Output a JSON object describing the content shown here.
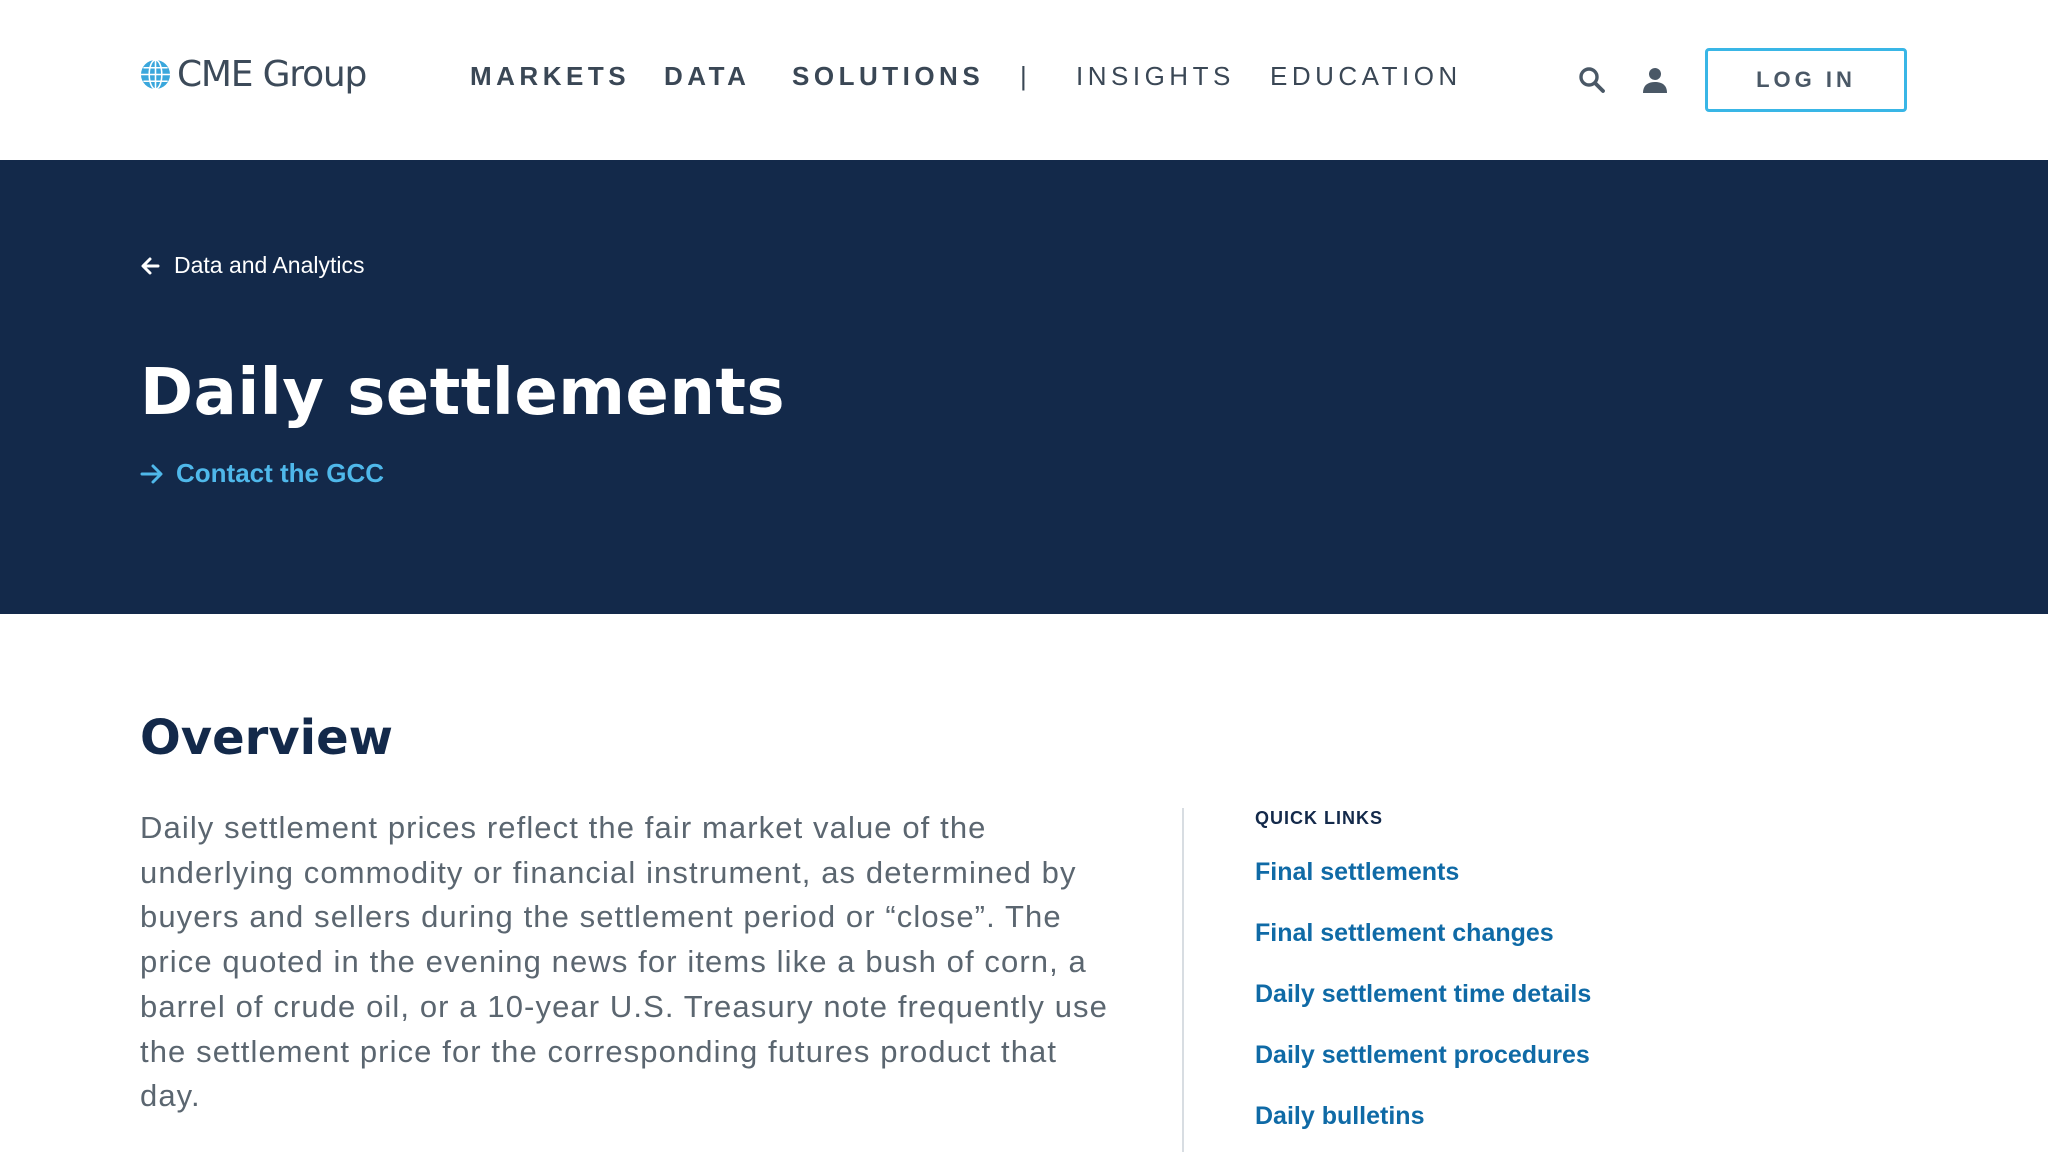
{
  "brand": {
    "name": "CME Group",
    "logo_icon": "globe-icon",
    "accent": "#39b6e6"
  },
  "nav": {
    "items": [
      {
        "label": "MARKETS"
      },
      {
        "label": "DATA"
      },
      {
        "label": "SOLUTIONS"
      },
      {
        "label": "INSIGHTS"
      },
      {
        "label": "EDUCATION"
      }
    ],
    "separator": "|",
    "search_icon": "search-icon",
    "account_icon": "user-icon",
    "login_label": "LOG IN"
  },
  "hero": {
    "background": "#13294a",
    "breadcrumb": "Data and Analytics",
    "title": "Daily settlements",
    "contact_link": "Contact the GCC"
  },
  "overview": {
    "heading": "Overview",
    "body": "Daily settlement prices reflect the fair market value of the underlying commodity or financial instrument, as determined by buyers and sellers during the settlement period or “close”. The price quoted in the evening news for items like a bush of corn, a barrel of crude oil, or a 10-year U.S. Treasury note frequently use the settlement price for the corresponding futures product that day."
  },
  "quick_links": {
    "title": "QUICK LINKS",
    "items": [
      {
        "label": "Final settlements"
      },
      {
        "label": "Final settlement changes"
      },
      {
        "label": "Daily settlement time details"
      },
      {
        "label": "Daily settlement procedures"
      },
      {
        "label": "Daily bulletins"
      }
    ]
  }
}
